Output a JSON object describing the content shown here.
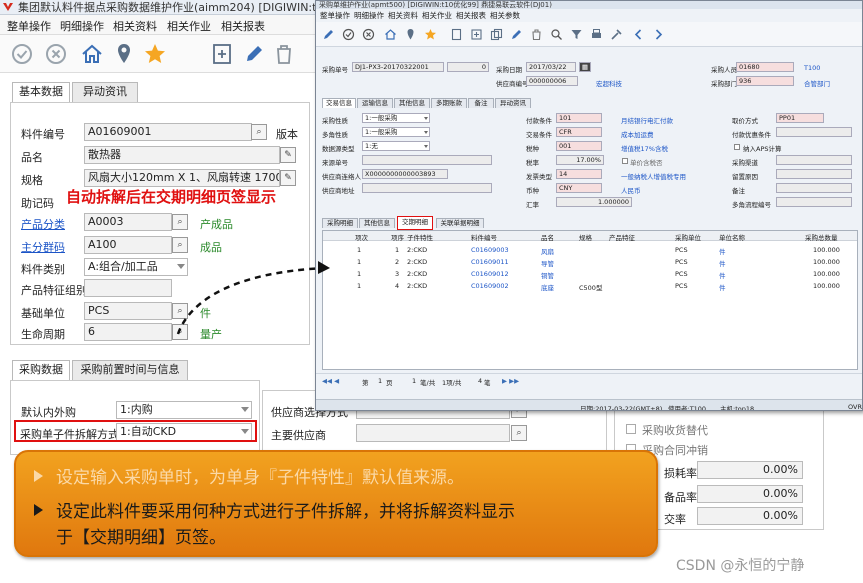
{
  "window": {
    "title": "集团默认料件据点采购数据维护作业(aimm204)",
    "title_suffix": "[DIGIWIN:t10"
  },
  "menu": [
    "整单操作",
    "明细操作",
    "相关资料",
    "相关作业",
    "相关报表"
  ],
  "toolbar_icons": [
    "check-icon",
    "cancel-icon",
    "home-icon",
    "pin-icon",
    "star-icon",
    "add-icon",
    "edit-icon",
    "delete-icon"
  ],
  "basic_tabs": [
    "基本数据",
    "异动资讯"
  ],
  "basic": {
    "item_no_label": "料件编号",
    "item_no": "A01609001",
    "version_label": "版本",
    "name_label": "品名",
    "name": "散热器",
    "spec_label": "规格",
    "spec": "风扇大小120mm X 1、风扇转速 1700rpm",
    "mnemonic_label": "助记码",
    "category_label": "产品分类",
    "category": "A0003",
    "category_desc": "产成品",
    "group_label": "主分群码",
    "group": "A100",
    "group_desc": "成品",
    "type_label": "料件类别",
    "type": "A:组合/加工品",
    "feature_group_label": "产品特征组别",
    "unit_label": "基础单位",
    "unit": "PCS",
    "unit_desc": "件",
    "lifecycle_label": "生命周期",
    "lifecycle": "6",
    "lifecycle_desc": "量产"
  },
  "annotation": "自动拆解后在交期明细页签显示",
  "purchase_tabs": [
    "采购数据",
    "采购前置时间与信息"
  ],
  "purchase": {
    "inout_label": "默认内外购",
    "inout": "1:内购",
    "kit_label": "采购单子件拆解方式",
    "kit": "1:自动CKD",
    "supplier_label_a": "供应商选择方式",
    "main_supplier_label": "主要供应商",
    "right_checks": [
      "采购收货替代",
      "采购合同冲销"
    ],
    "right_rows": [
      {
        "label": "损耗率",
        "value": "0.00%"
      },
      {
        "label": "备品率",
        "value": "0.00%"
      },
      {
        "label": "交率",
        "value": "0.00%"
      }
    ]
  },
  "callout": {
    "bullet1": "设定输入采购单时，为单身『子件特性』默认值来源。",
    "bullet2_line1": "设定此料件要采用何种方式进行子件拆解，并将拆解资料显示",
    "bullet2_line2": "于【交期明细】页签。"
  },
  "watermark": "CSDN @永恒的宁静",
  "overlay": {
    "title": "采购单维护作业(apmt500)   [DIGIWIN:t10优化99]  鼎捷易联云软件(DJ01)",
    "menu": [
      "整单操作",
      "明细操作",
      "相关资料",
      "相关作业",
      "相关报表",
      "相关参数"
    ],
    "head": {
      "po_label": "采购单号",
      "po": "DJ1-PX3-20170322001",
      "po_seq": "0",
      "date_label": "采购日期",
      "date": "2017/03/22",
      "buyer_label": "采购人员",
      "buyer": "01680",
      "buyer_name": "T100",
      "supplier_label": "供应商编号",
      "supplier": "000000006",
      "supplier_name": "宏超科技",
      "dept_label": "采购部门",
      "dept": "936",
      "dept_name": "合管部门"
    },
    "tabs": [
      "交易信息",
      "运输信息",
      "其他信息",
      "多期账款",
      "备注",
      "异动资讯"
    ],
    "left": [
      {
        "label": "采购性质",
        "value": "1:一般采购"
      },
      {
        "label": "多角性质",
        "value": "1:一般采购"
      },
      {
        "label": "数据源类型",
        "value": "1:无"
      },
      {
        "label": "来源单号",
        "value": ""
      },
      {
        "label": "供应商连络人",
        "value": "X0000000000003893"
      },
      {
        "label": "供应商地址",
        "value": ""
      }
    ],
    "mid": [
      {
        "label": "付款条件",
        "value": "101",
        "desc": "月结银行电汇付款"
      },
      {
        "label": "交易条件",
        "value": "CFR",
        "desc": "成本加运费"
      },
      {
        "label": "税种",
        "value": "001",
        "desc": "增值税17%含税"
      },
      {
        "label": "税率",
        "value": "17.00%",
        "desc": "单价含税否"
      },
      {
        "label": "发票类型",
        "value": "14",
        "desc": "一般纳税人增值税专用"
      },
      {
        "label": "币种",
        "value": "CNY",
        "desc": "人民币"
      },
      {
        "label": "汇率",
        "value": "1.000000",
        "desc": ""
      }
    ],
    "right": [
      {
        "label": "取价方式",
        "value": "PP01"
      },
      {
        "label": "付款优惠条件",
        "value": ""
      },
      {
        "label": "纳入APS计算",
        "value": ""
      },
      {
        "label": "采购渠道",
        "value": ""
      },
      {
        "label": "留置原因",
        "value": ""
      },
      {
        "label": "备注",
        "value": ""
      },
      {
        "label": "多角流程编号",
        "value": ""
      }
    ],
    "lower_tabs": [
      "采购明细",
      "其他信息",
      "交期明细",
      "关联单据明细"
    ],
    "grid_headers": [
      "项次",
      "项序",
      "子件特性",
      "料件编号",
      "品名",
      "规格",
      "产品特征",
      "采购单位",
      "单位名称",
      "采购总数量"
    ],
    "grid_rows": [
      {
        "seq": "1",
        "sub": "1",
        "kind": "2:CKD",
        "item": "C01609003",
        "name": "风扇",
        "spec": "",
        "unit": "PCS",
        "unit_name": "件",
        "qty": "100.000"
      },
      {
        "seq": "1",
        "sub": "2",
        "kind": "2:CKD",
        "item": "C01609011",
        "name": "导管",
        "spec": "",
        "unit": "PCS",
        "unit_name": "件",
        "qty": "100.000"
      },
      {
        "seq": "1",
        "sub": "3",
        "kind": "2:CKD",
        "item": "C01609012",
        "name": "铜管",
        "spec": "",
        "unit": "PCS",
        "unit_name": "件",
        "qty": "100.000"
      },
      {
        "seq": "1",
        "sub": "4",
        "kind": "2:CKD",
        "item": "C01609002",
        "name": "底座",
        "spec": "C500型",
        "unit": "PCS",
        "unit_name": "件",
        "qty": "100.000"
      }
    ],
    "nav": {
      "page": "第",
      "count": "1",
      "unit": "页",
      "total": "1",
      "total_label": "笔/共",
      "of_rows": "1项/共",
      "rows_total": "4",
      "rows_label": "笔"
    },
    "status": {
      "date": "日期:2017-03-22(GMT+8)",
      "user": "使用者:T100",
      "host": "主机:top18",
      "extra": "OVR"
    }
  }
}
